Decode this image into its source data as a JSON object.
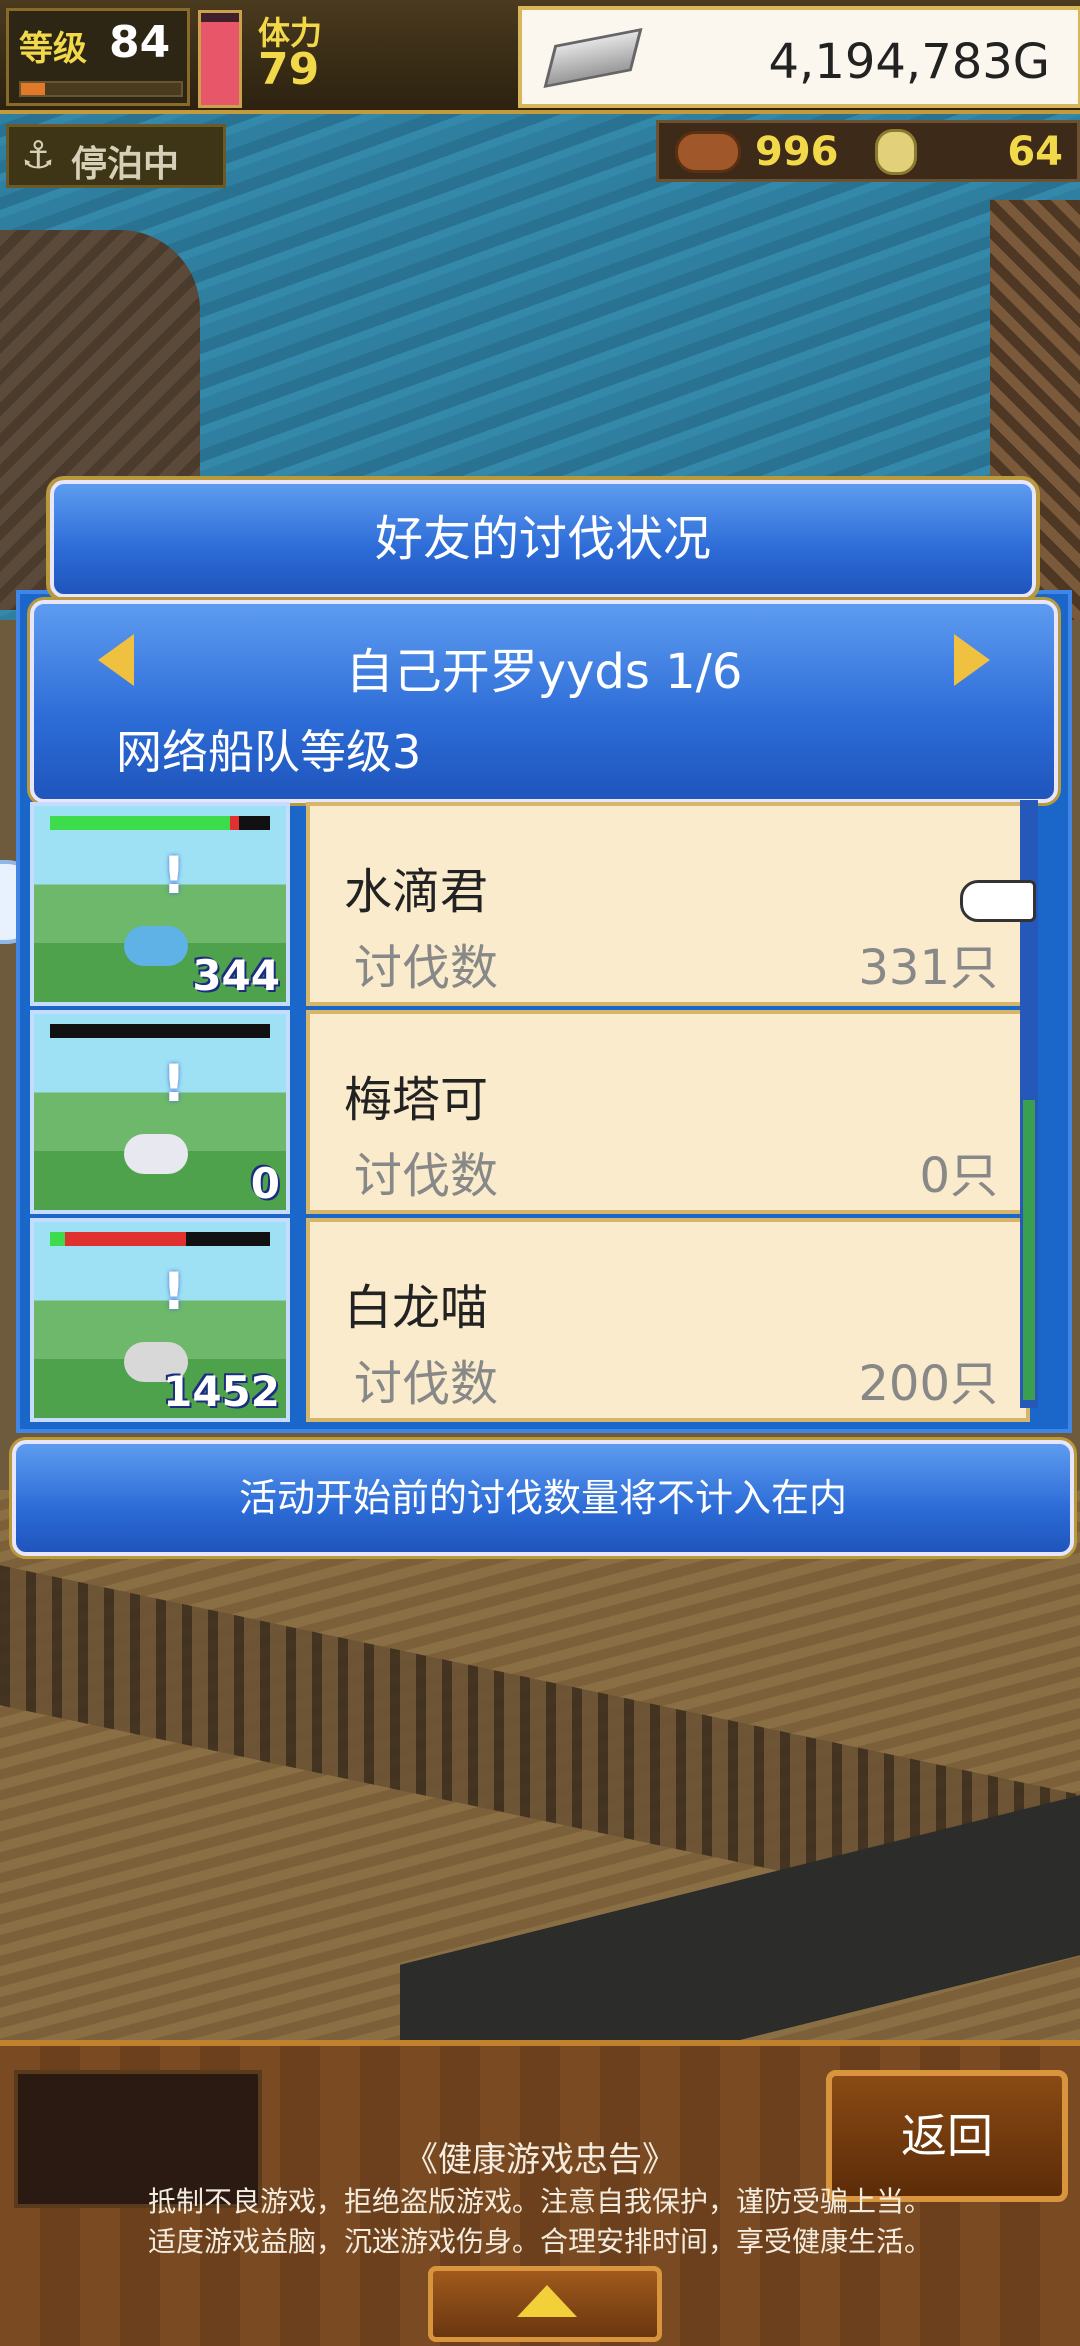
{
  "hud": {
    "level_label": "等级",
    "level_value": "84",
    "level_progress": 0.15,
    "stamina_label": "体力",
    "stamina_value": "79",
    "stamina_fill": 0.9,
    "gold": "4,194,783G",
    "dock_status": "停泊中",
    "resource_1": "996",
    "resource_2": "64"
  },
  "dialog": {
    "title": "好友的讨伐状况",
    "friend_name": "自己开罗yyds 1/6",
    "fleet_level": "网络船队等级3",
    "monsters": [
      {
        "name": "水滴君",
        "kill_label": "讨伐数",
        "kill_value": "331只",
        "thumb_count": "344",
        "hp_green": 0.82,
        "hp_red": 0.04,
        "color": "#5fb2e6"
      },
      {
        "name": "梅塔可",
        "kill_label": "讨伐数",
        "kill_value": "0只",
        "thumb_count": "0",
        "hp_green": 0.0,
        "hp_red": 0.0,
        "color": "#e8e8f0"
      },
      {
        "name": "白龙喵",
        "kill_label": "讨伐数",
        "kill_value": "200只",
        "thumb_count": "1452",
        "hp_green": 0.07,
        "hp_red": 0.55,
        "color": "#d8d8d8"
      }
    ],
    "note": "活动开始前的讨伐数量将不计入在内"
  },
  "footer": {
    "back_label": "返回",
    "health_title": "《健康游戏忠告》",
    "health_line_1": "抵制不良游戏，拒绝盗版游戏。注意自我保护，谨防受骗上当。",
    "health_line_2": "适度游戏益脑，沉迷游戏伤身。合理安排时间，享受健康生活。"
  },
  "colors": {
    "accent_blue": "#2c6bd6",
    "info_bg": "#f9ebcb",
    "gold_text": "#f2d94a"
  }
}
